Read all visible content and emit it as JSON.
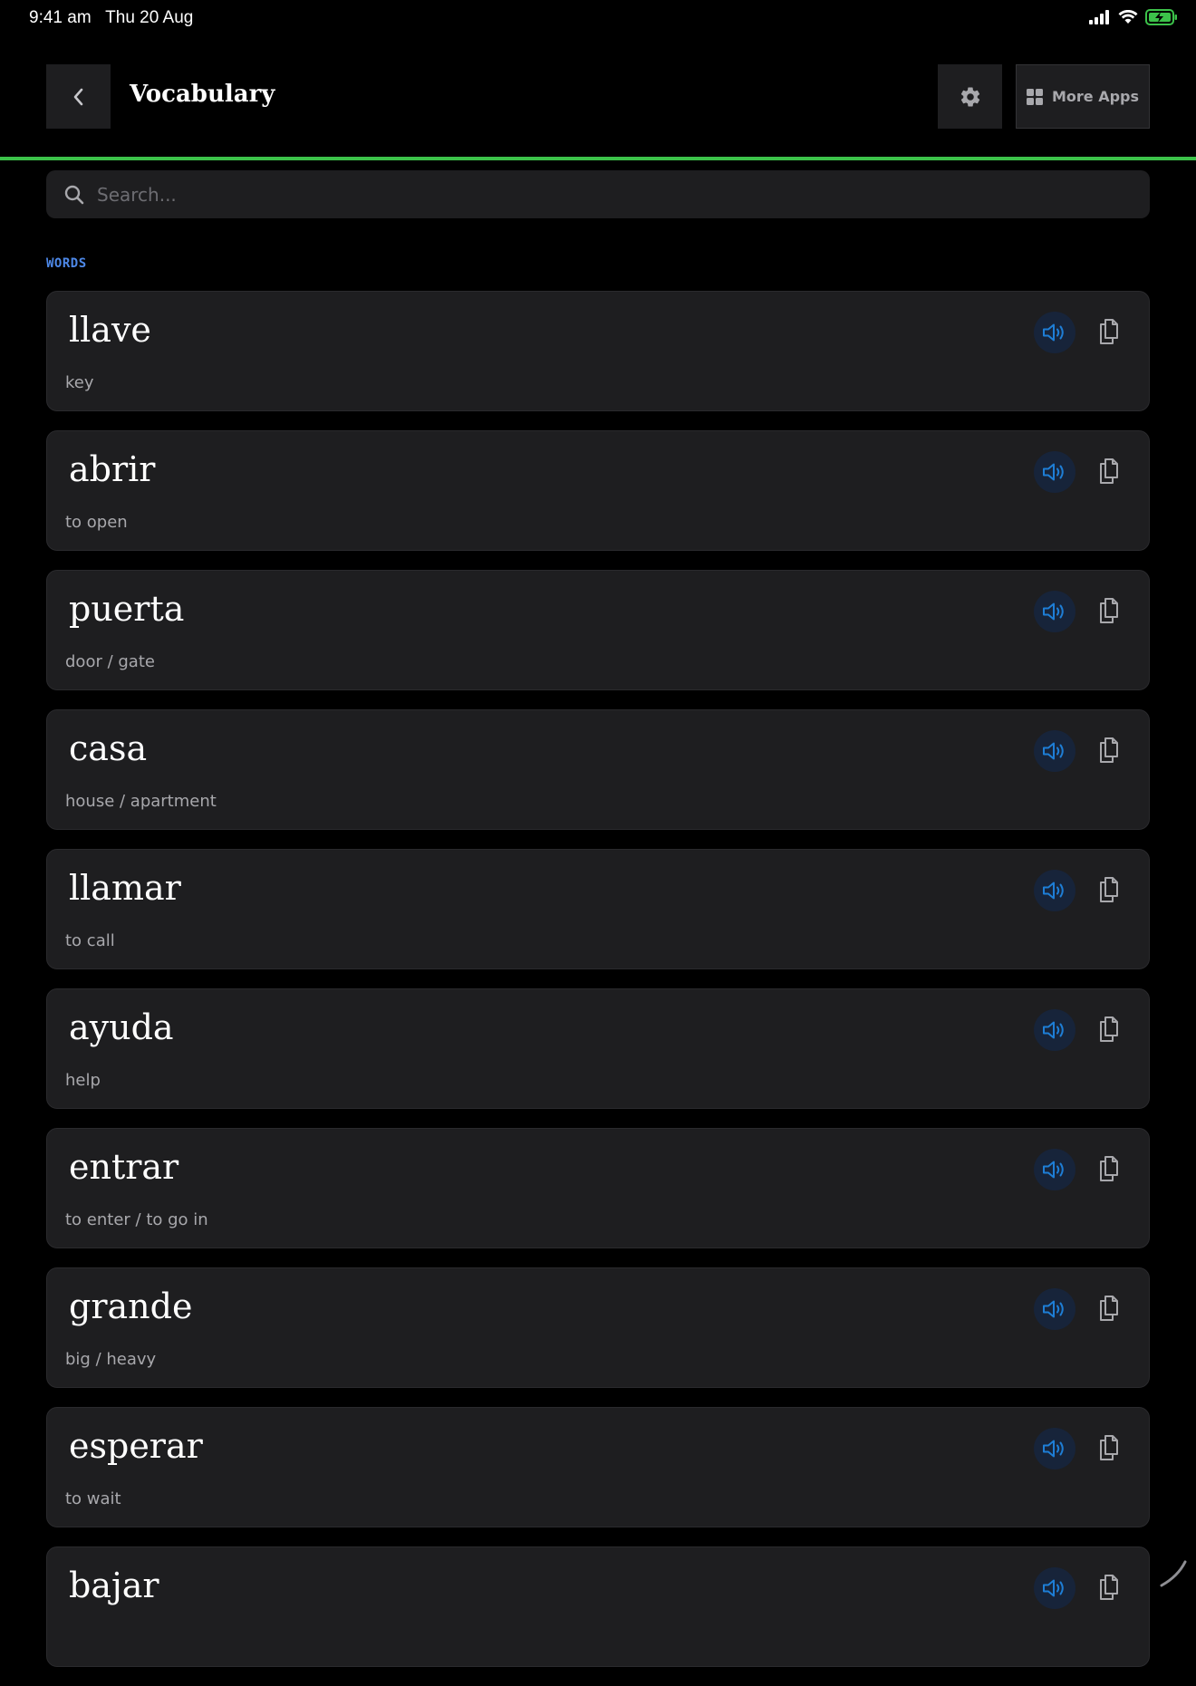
{
  "status_bar": {
    "time": "9:41 am",
    "date": "Thu 20 Aug"
  },
  "header": {
    "title": "Vocabulary",
    "more_apps_label": "More Apps"
  },
  "search": {
    "placeholder": "Search..."
  },
  "section_label": "WORDS",
  "colors": {
    "accent_line": "#3cc24a",
    "section_label": "#4d88e8",
    "speaker": "#1e7ed6",
    "card": "#1e1e20",
    "battery": "#3cc24a"
  },
  "words": [
    {
      "term": "llave",
      "meaning": "key"
    },
    {
      "term": "abrir",
      "meaning": "to open"
    },
    {
      "term": "puerta",
      "meaning": "door / gate"
    },
    {
      "term": "casa",
      "meaning": "house / apartment"
    },
    {
      "term": "llamar",
      "meaning": "to call"
    },
    {
      "term": "ayuda",
      "meaning": "help"
    },
    {
      "term": "entrar",
      "meaning": "to enter / to go in"
    },
    {
      "term": "grande",
      "meaning": "big / heavy"
    },
    {
      "term": "esperar",
      "meaning": "to wait"
    },
    {
      "term": "bajar",
      "meaning": ""
    }
  ]
}
